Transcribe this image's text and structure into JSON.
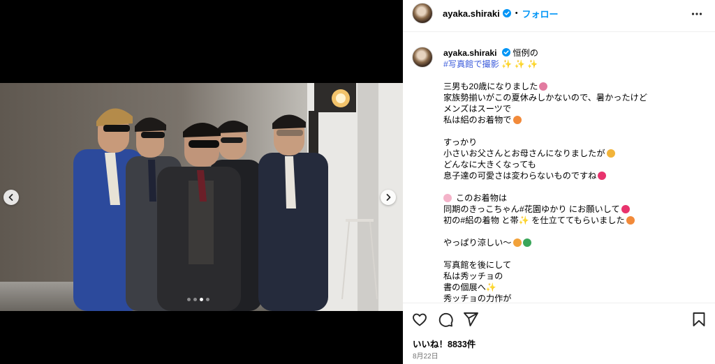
{
  "post": {
    "username": "ayaka.shiraki",
    "separator": "•",
    "follow_label": "フォロー",
    "likes": "いいね！8833件",
    "date": "8月22日"
  },
  "caption": {
    "username": "ayaka.shiraki",
    "lines": [
      "恒例の",
      "#写真館で撮影 ✨ ✨ ✨",
      "",
      "三男も20歳になりました",
      "家族勢揃いがこの夏休みしかないので、暑かったけど",
      "メンズはスーツで",
      "私は絽のお着物で",
      "",
      "すっかり",
      "小さいお父さんとお母さんになりましたが",
      "どんなに大きくなっても",
      "息子達の可愛さは変わらないものですね",
      "",
      "このお着物は",
      "同期のきっこちゃん#花園ゆかり にお願いして",
      "初の#絽の着物 と帯✨ を仕立ててもらいました",
      "",
      "やっぱり涼しい〜",
      "",
      "写真館を後にして",
      "私は秀ッチョの",
      "書の個展へ✨",
      "秀ッチョの力作が"
    ]
  },
  "carousel": {
    "count": 4,
    "active_index": 2
  },
  "icons": {
    "verified": "verified-badge-icon",
    "more": "more-options-icon",
    "like": "heart-icon",
    "comment": "comment-icon",
    "share": "share-icon",
    "save": "bookmark-icon",
    "prev": "chevron-left-icon",
    "next": "chevron-right-icon"
  },
  "colors": {
    "link": "#0095f6",
    "hashtag": "#3b5bdb",
    "verified": "#0095f6",
    "muted": "#737373"
  }
}
